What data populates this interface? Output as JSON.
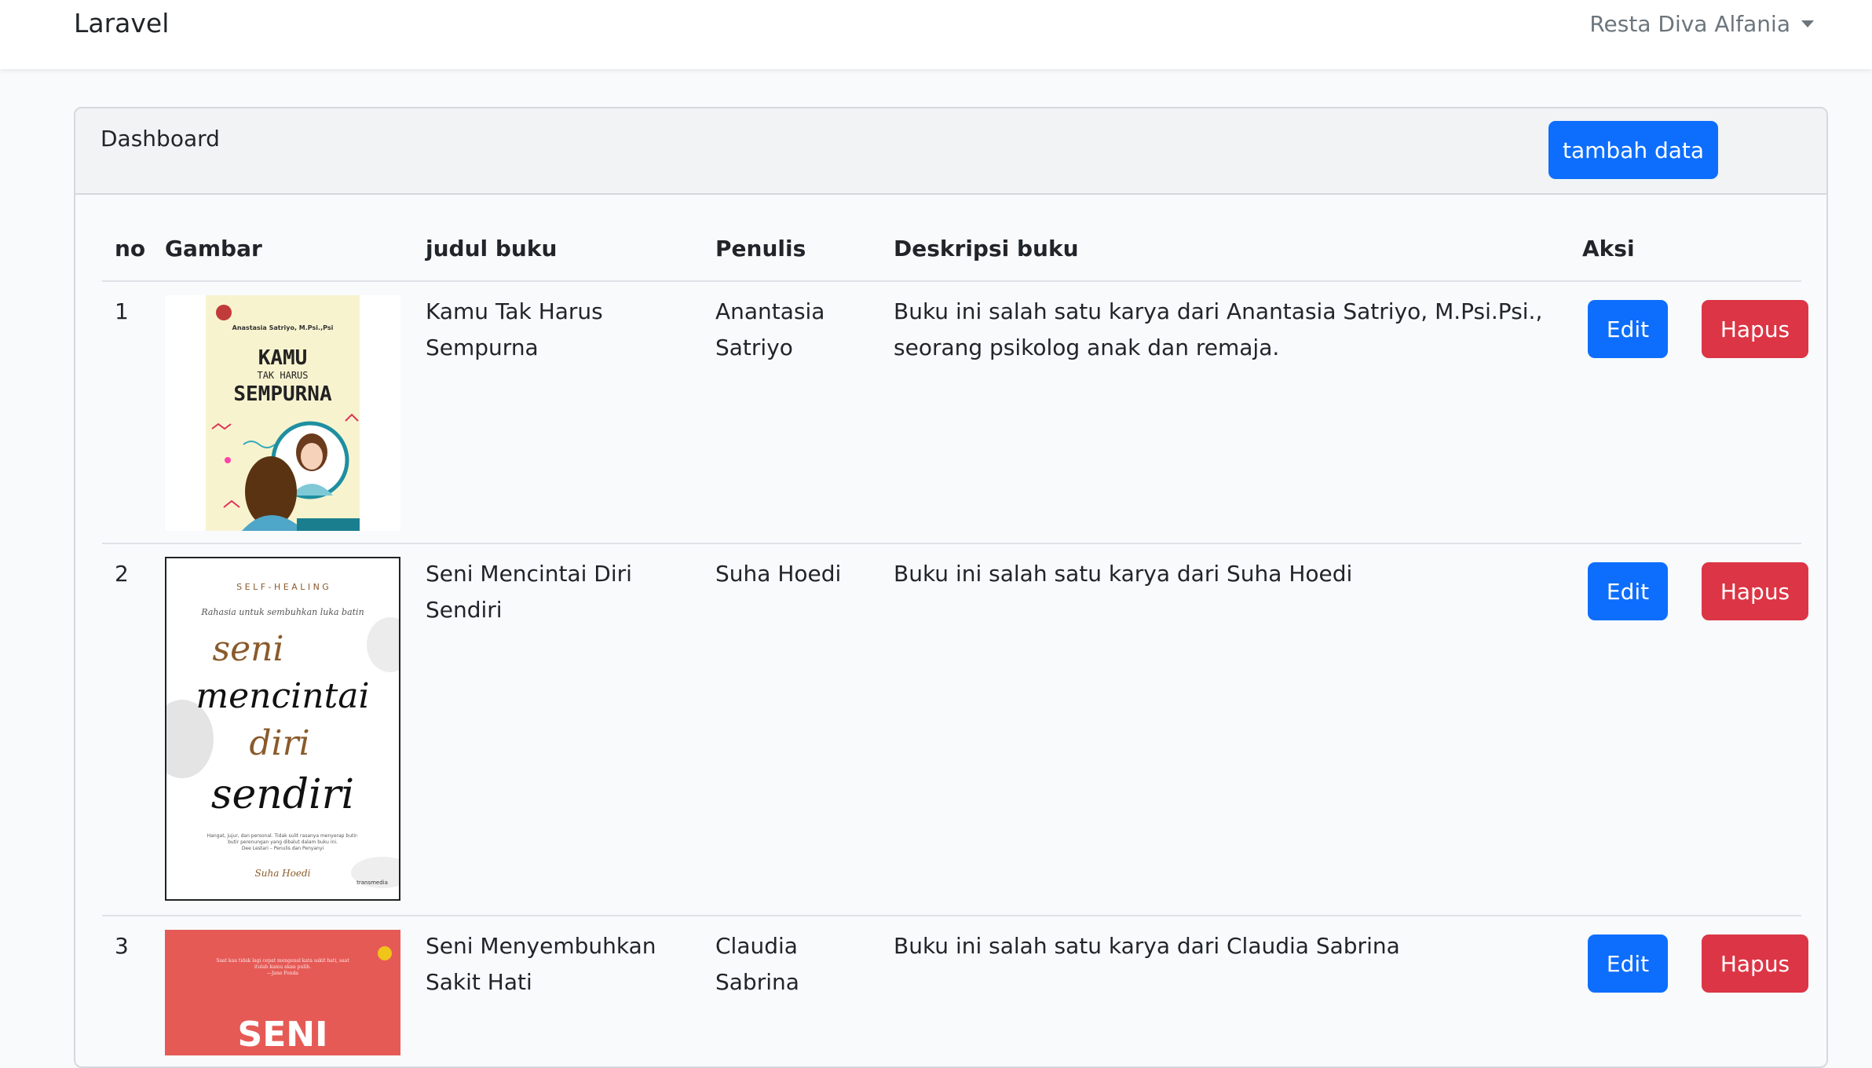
{
  "navbar": {
    "brand": "Laravel",
    "user": "Resta Diva Alfania"
  },
  "card": {
    "title": "Dashboard",
    "add_button": "tambah data"
  },
  "table": {
    "headers": [
      "no",
      "Gambar",
      "judul buku",
      "Penulis",
      "Deskripsi buku",
      "Aksi"
    ],
    "rows": [
      {
        "no": "1",
        "title_lines": [
          "Kamu Tak Harus",
          "Sempurna"
        ],
        "author_lines": [
          "Anantasia",
          "Satriyo"
        ],
        "desc_lines": [
          "Buku ini salah satu karya dari Anantasia Satriyo, M.Psi.Psi.,",
          "seorang psikolog anak dan remaja."
        ],
        "cover": {
          "author": "Anastasia Satriyo, M.Psi.,Psi",
          "line1": "KAMU",
          "line2": "TAK HARUS",
          "line3": "SEMPURNA"
        }
      },
      {
        "no": "2",
        "title_lines": [
          "Seni Mencintai Diri",
          "Sendiri"
        ],
        "author_lines": [
          "Suha Hoedi"
        ],
        "desc_lines": [
          "Buku ini salah satu karya dari Suha Hoedi"
        ],
        "cover": {
          "top": "S E L F - H E A L I N G",
          "sub": "Rahasia untuk sembuhkan luka batin",
          "w1": "seni",
          "w2": "mencintai",
          "w3": "diri",
          "w4": "sendiri",
          "quote": "Hangat, jujur, dan personal. Tidak sulit rasanya menyerap butir-butir perenungan yang dibalut dalam buku ini.",
          "quote_by": "Dee Lestari – Penulis dan Penyanyi",
          "author": "Suha Hoedi",
          "publisher": "transmedia"
        }
      },
      {
        "no": "3",
        "title_lines": [
          "Seni Menyembuhkan",
          "Sakit Hati"
        ],
        "author_lines": [
          "Claudia",
          "Sabrina"
        ],
        "desc_lines": [
          "Buku ini salah satu karya dari Claudia Sabrina"
        ],
        "cover": {
          "quote": "Saat kau tidak lagi cepat mengenal kata sakit hati, saat itulah kamu akan pulih.",
          "quote_by": "—Jane Fonda",
          "big": "SENI"
        }
      }
    ],
    "edit_label": "Edit",
    "delete_label": "Hapus"
  },
  "colors": {
    "primary": "#0d6efd",
    "danger": "#dc3545",
    "cover3": "#e65a56"
  }
}
